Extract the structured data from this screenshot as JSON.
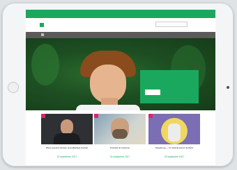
{
  "site": {
    "topbar_left": [
      "",
      ""
    ],
    "topbar_right": [
      "",
      "",
      "",
      ""
    ],
    "brand": "",
    "tagline": "",
    "search_placeholder": ""
  },
  "nav": {
    "items": [
      "",
      "",
      "",
      ""
    ]
  },
  "hero": {
    "title": "",
    "button_label": ""
  },
  "cards": [
    {
      "tag": "",
      "title": "Pierre-Laurent Aimard, Jean-Baptiste Fonlupt",
      "date": "22 septembre 2017"
    },
    {
      "tag": "",
      "title": "Portraits de Cézanne",
      "date": "24 septembre 2017"
    },
    {
      "tag": "",
      "title": "Strasbourg — Un festival autour de Bach",
      "date": "23 septembre 2017"
    }
  ],
  "colors": {
    "brand_green": "#1aa85f",
    "nav_grey": "#5a5a5a",
    "tag_pink": "#d9276f"
  }
}
